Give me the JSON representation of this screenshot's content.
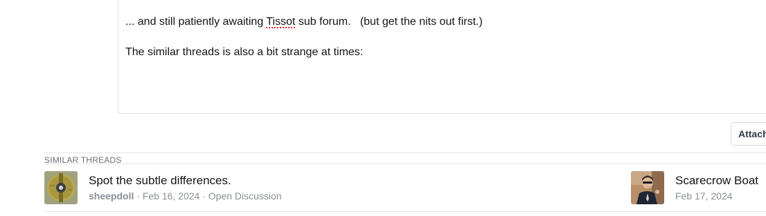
{
  "editor": {
    "line1_prefix": "... and still patiently awaiting ",
    "line1_misspelled": "Tissot",
    "line1_suffix": " sub forum.   (but get the nits out first.)",
    "line2": "The similar threads is also a bit strange at times:"
  },
  "attach_button": {
    "label": "Attach"
  },
  "similar_threads": {
    "heading": "SIMILAR THREADS",
    "items": [
      {
        "title": "Spot the subtle differences.",
        "author": "sheepdoll",
        "date": "Feb 16, 2024",
        "forum": "Open Discussion",
        "separator": " · "
      },
      {
        "title": "Scarecrow Boat",
        "date": "Feb 17, 2024"
      }
    ]
  },
  "colors": {
    "text": "#141414",
    "muted": "#8a8f96",
    "border": "#e2e4e7",
    "spellcheck": "#dd2222"
  }
}
